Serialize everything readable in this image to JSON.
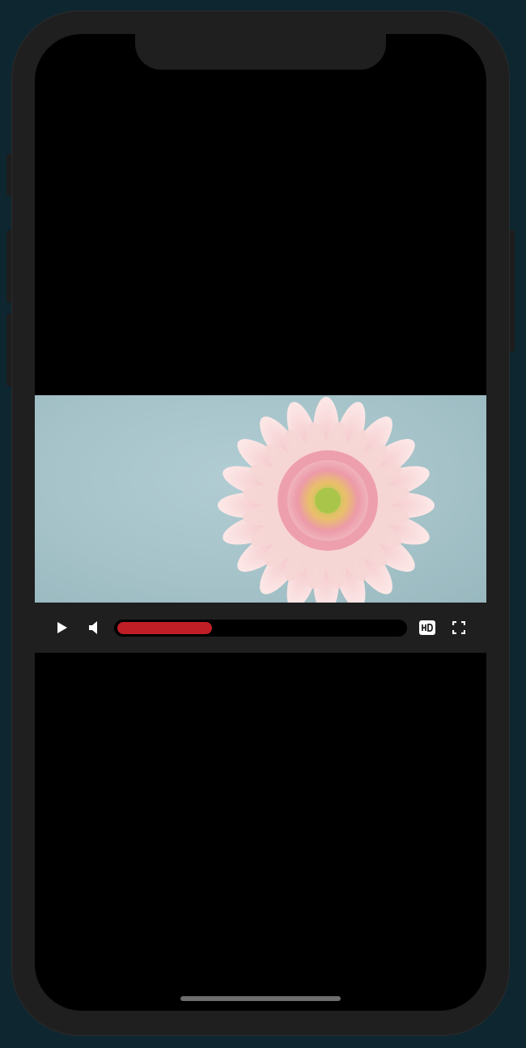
{
  "video": {
    "thumbnail": "pink-gerbera-daisy-on-light-blue-background"
  },
  "controls": {
    "play_icon": "play-icon",
    "volume_icon": "volume-icon",
    "progress": 0.33,
    "progress_color": "#c01e26",
    "hd_icon": "hd-icon",
    "fullscreen_icon": "fullscreen-icon"
  },
  "colors": {
    "background": "#0e2630",
    "device": "#1f1f1f",
    "screen": "#000000"
  }
}
